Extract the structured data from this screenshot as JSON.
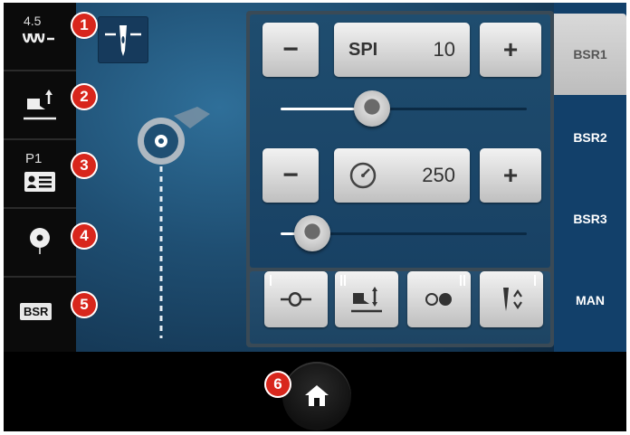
{
  "left_bar": {
    "stitch_length_value": "4.5",
    "program_label": "P1",
    "bsr_label": "BSR"
  },
  "stitch_settings": {
    "spi_label": "SPI",
    "spi_value": "10",
    "spi_slider_level": 0.37,
    "speed_value": "250",
    "speed_slider_level": 0.13,
    "minus_label": "−",
    "plus_label": "+"
  },
  "tabs": [
    {
      "label": "BSR1",
      "active": true
    },
    {
      "label": "BSR2",
      "active": false
    },
    {
      "label": "BSR3",
      "active": false
    },
    {
      "label": "MAN",
      "active": false
    }
  ],
  "callouts": [
    "1",
    "2",
    "3",
    "4",
    "5",
    "6"
  ],
  "colors": {
    "accent_red": "#d8261c",
    "panel_blue": "#184164",
    "tab_blue": "#12406a"
  }
}
